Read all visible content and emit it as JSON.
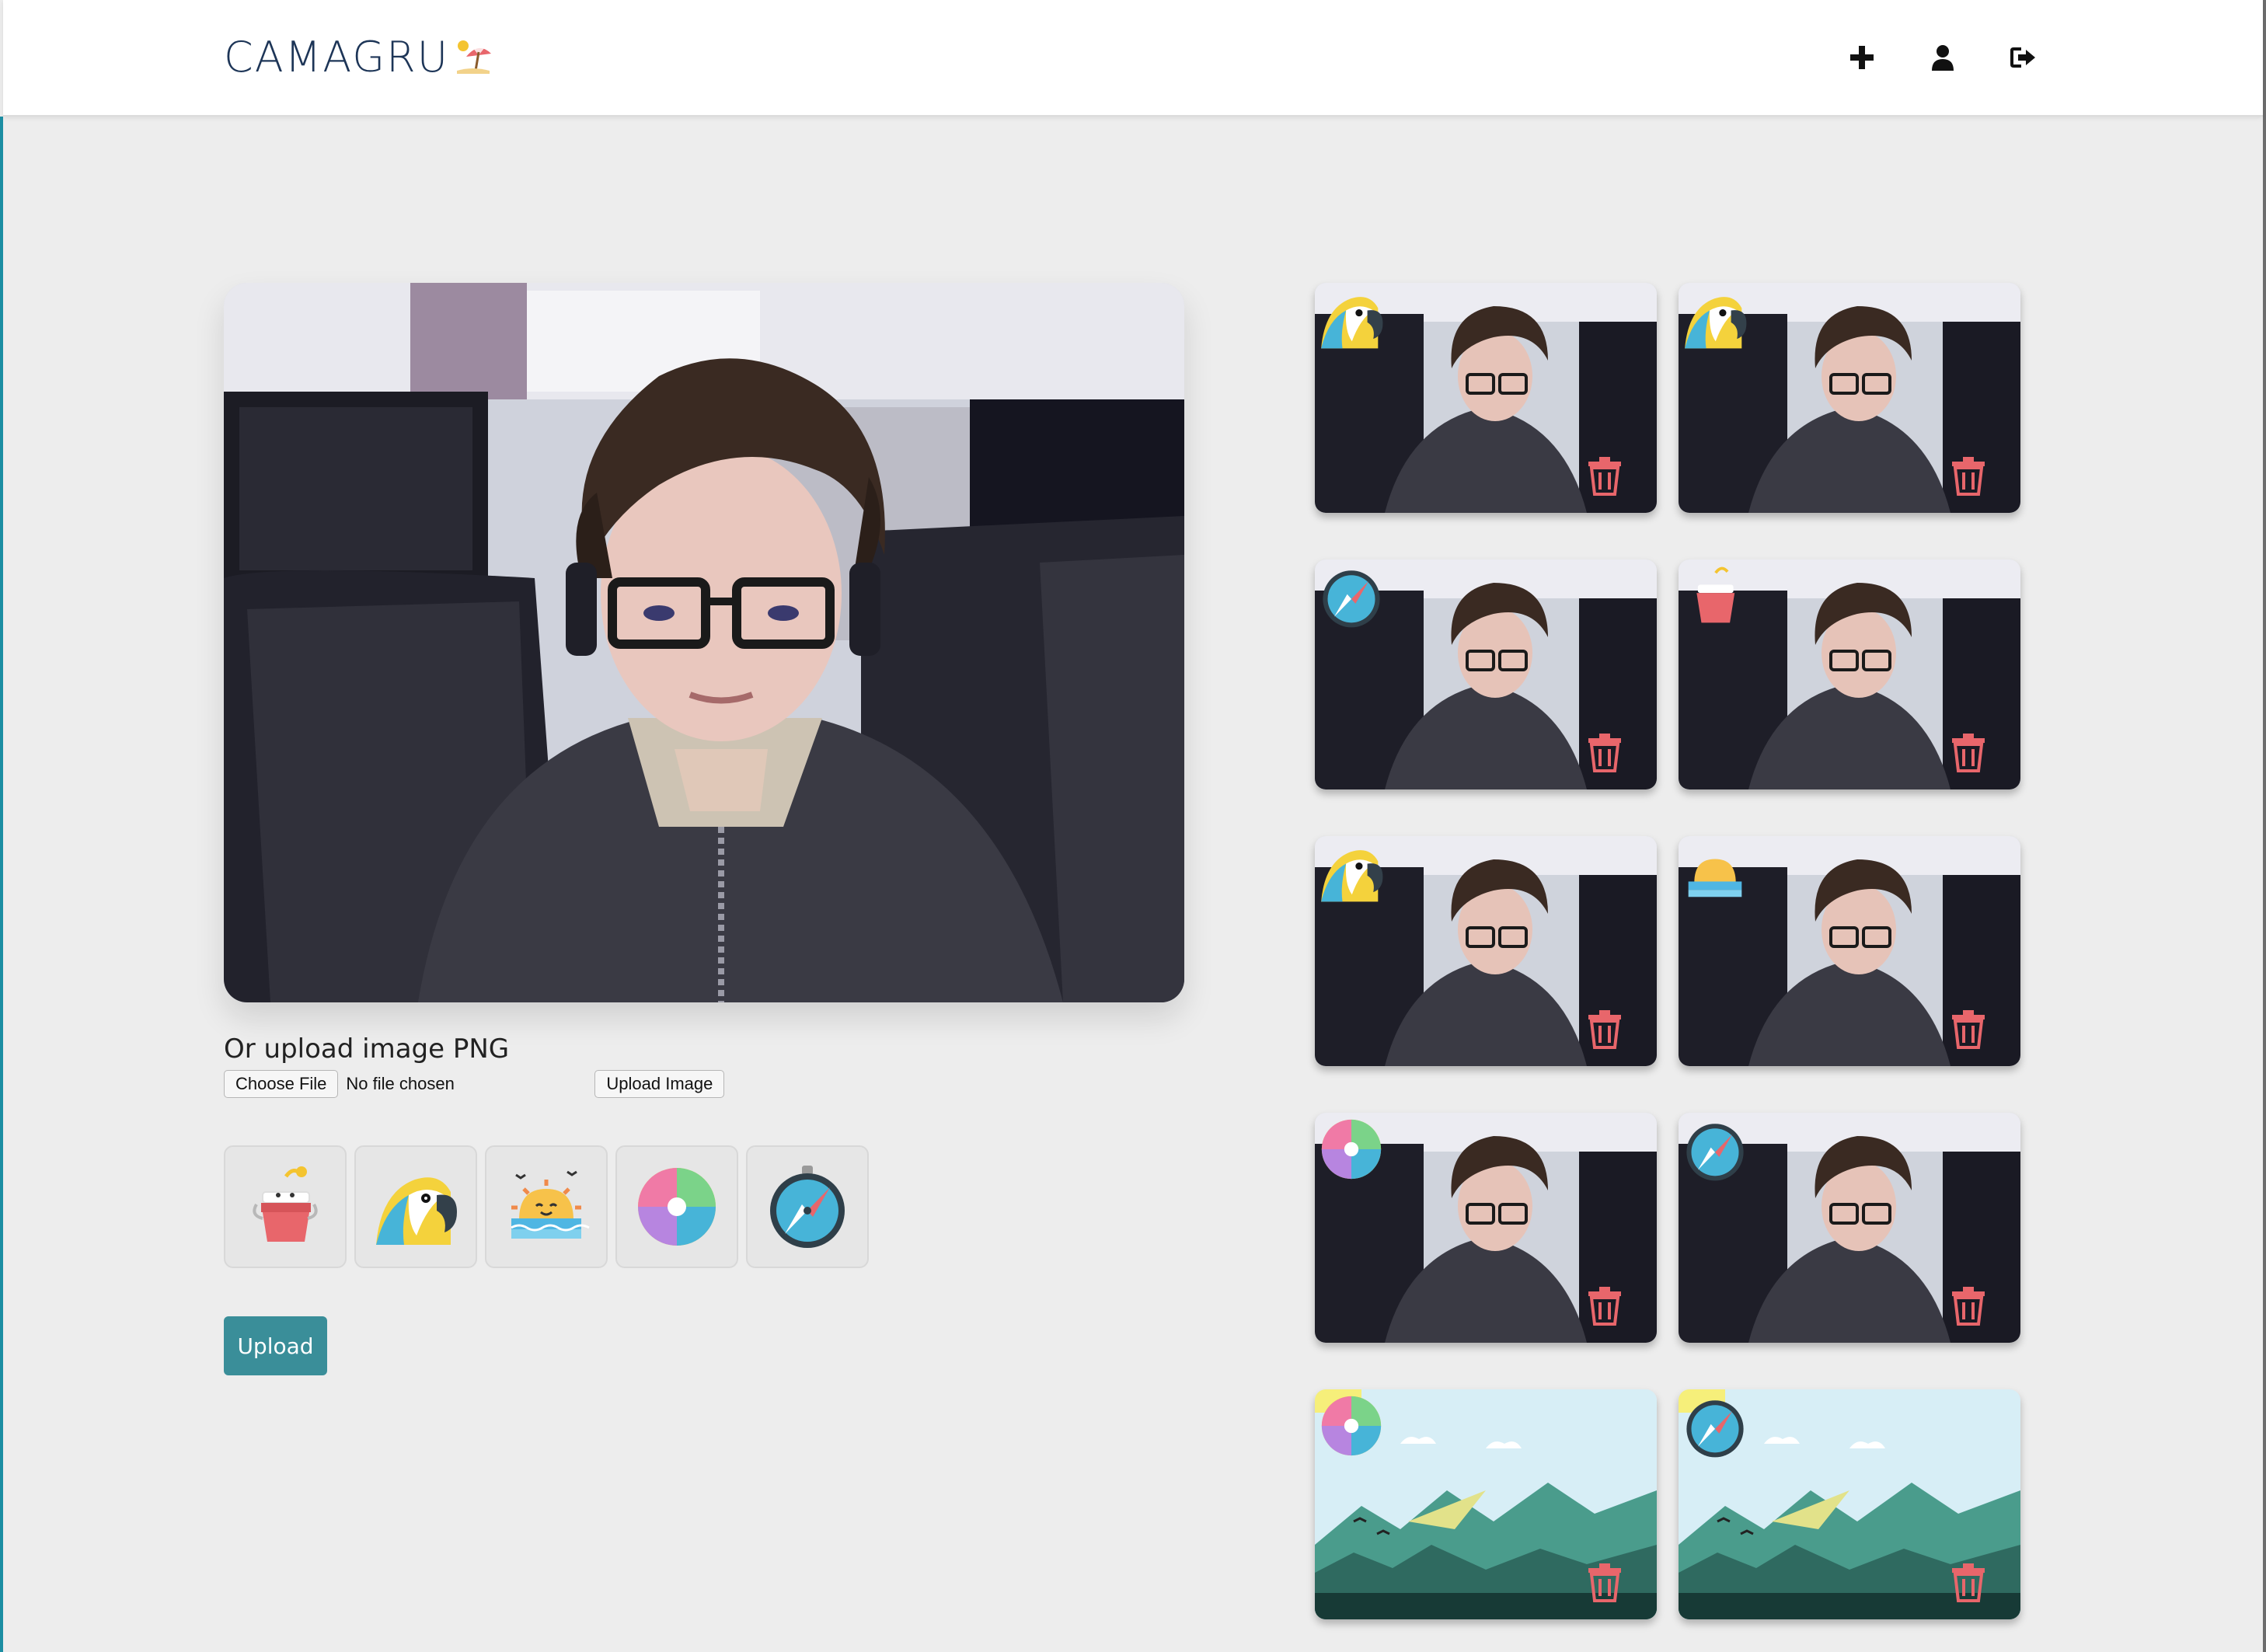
{
  "app": {
    "brand": "CAMAGRU",
    "brand_logo_icon": "beach-umbrella-icon",
    "accent_color": "#3a8e99",
    "trash_color": "#e8666b"
  },
  "nav": {
    "items": [
      {
        "icon": "plus-icon",
        "name": "new-post"
      },
      {
        "icon": "user-icon",
        "name": "profile"
      },
      {
        "icon": "logout-icon",
        "name": "logout"
      }
    ]
  },
  "editor": {
    "upload_label": "Or upload image PNG",
    "choose_file_label": "Choose File",
    "no_file_text": "No file chosen",
    "upload_image_label": "Upload Image",
    "upload_button_label": "Upload",
    "stickers": [
      "bucket-icon",
      "parrot-icon",
      "sunset-icon",
      "beach-ball-icon",
      "compass-icon"
    ]
  },
  "gallery": {
    "items": [
      {
        "photo": "webcam",
        "sticker": "parrot-icon"
      },
      {
        "photo": "webcam",
        "sticker": "parrot-icon"
      },
      {
        "photo": "webcam",
        "sticker": "compass-icon"
      },
      {
        "photo": "webcam",
        "sticker": "bucket-icon"
      },
      {
        "photo": "webcam",
        "sticker": "parrot-icon"
      },
      {
        "photo": "webcam",
        "sticker": "sunset-icon"
      },
      {
        "photo": "webcam",
        "sticker": "beach-ball-icon"
      },
      {
        "photo": "webcam",
        "sticker": "compass-icon"
      },
      {
        "photo": "landscape",
        "sticker": "beach-ball-icon"
      },
      {
        "photo": "landscape",
        "sticker": "compass-icon"
      }
    ]
  }
}
